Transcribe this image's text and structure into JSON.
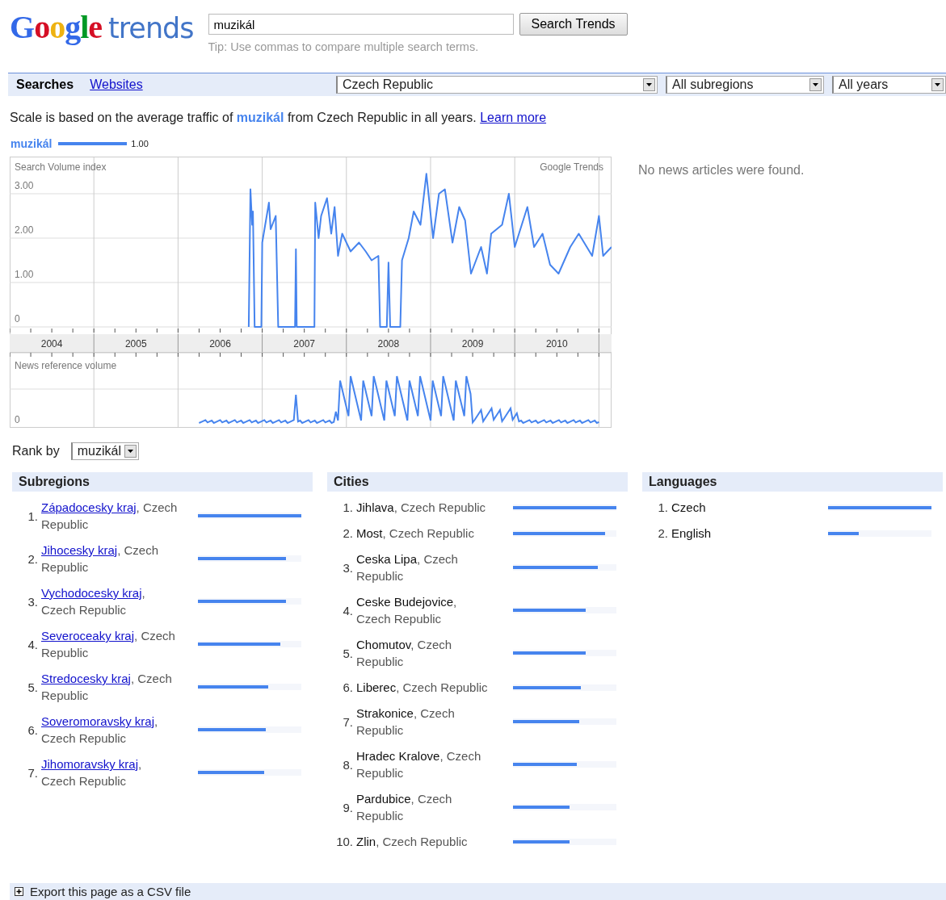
{
  "logo": {
    "brand": "Google",
    "product": "trends"
  },
  "search": {
    "value": "muzikál",
    "button": "Search Trends",
    "tip": "Tip: Use commas to compare multiple search terms."
  },
  "nav": {
    "tabs": [
      {
        "label": "Searches",
        "selected": true
      },
      {
        "label": "Websites",
        "selected": false
      }
    ],
    "filters": [
      {
        "value": "Czech Republic"
      },
      {
        "value": "All subregions"
      },
      {
        "value": "All years"
      }
    ]
  },
  "scale_note": {
    "before": "Scale is based on the average traffic of ",
    "term": "muzikál",
    "after": " from Czech Republic in all years.",
    "link": "Learn more"
  },
  "legend": {
    "value": "1.00"
  },
  "chart": {
    "source": "Google Trends",
    "chart_data": {
      "type": "line",
      "title": "Search Volume index",
      "grid": true,
      "xlim": [
        2004,
        2011.15
      ],
      "ylim": [
        0,
        3.8
      ],
      "xticks": [
        {
          "value": 2004.5,
          "label": "2004"
        },
        {
          "value": 2005.5,
          "label": "2005"
        },
        {
          "value": 2006.5,
          "label": "2006"
        },
        {
          "value": 2007.5,
          "label": "2007"
        },
        {
          "value": 2008.5,
          "label": "2008"
        },
        {
          "value": 2009.5,
          "label": "2009"
        },
        {
          "value": 2010.5,
          "label": "2010"
        }
      ],
      "yticks": [
        {
          "value": 0,
          "label": "0"
        },
        {
          "value": 1,
          "label": "1.00"
        },
        {
          "value": 2,
          "label": "2.00"
        },
        {
          "value": 3,
          "label": "3.00"
        }
      ],
      "x": [
        2006.84,
        2006.86,
        2006.88,
        2006.89,
        2006.91,
        2006.99,
        2007.0,
        2007.08,
        2007.1,
        2007.16,
        2007.19,
        2007.39,
        2007.4,
        2007.41,
        2007.62,
        2007.63,
        2007.67,
        2007.7,
        2007.77,
        2007.82,
        2007.86,
        2007.9,
        2007.95,
        2008.05,
        2008.15,
        2008.23,
        2008.3,
        2008.38,
        2008.4,
        2008.48,
        2008.5,
        2008.52,
        2008.64,
        2008.66,
        2008.74,
        2008.8,
        2008.88,
        2008.95,
        2009.03,
        2009.1,
        2009.17,
        2009.26,
        2009.34,
        2009.41,
        2009.48,
        2009.6,
        2009.67,
        2009.72,
        2009.85,
        2009.93,
        2010.0,
        2010.15,
        2010.23,
        2010.33,
        2010.42,
        2010.52,
        2010.66,
        2010.76,
        2010.92,
        2011.0,
        2011.05,
        2011.15
      ],
      "series": [
        {
          "name": "muzikál",
          "color": "#4684ee",
          "values": [
            0,
            3.1,
            2.3,
            2.6,
            0,
            0,
            1.9,
            2.8,
            2.2,
            2.5,
            0,
            0,
            1.75,
            0,
            0,
            2.8,
            2.0,
            2.5,
            2.9,
            2.1,
            2.7,
            1.6,
            2.1,
            1.7,
            1.9,
            1.7,
            1.5,
            1.6,
            0,
            0,
            1.45,
            0,
            0,
            1.5,
            2.0,
            2.6,
            2.3,
            3.45,
            2.0,
            3.0,
            3.1,
            1.9,
            2.7,
            2.4,
            1.2,
            1.8,
            1.2,
            2.1,
            2.3,
            3.0,
            1.8,
            2.7,
            1.8,
            2.1,
            1.4,
            1.2,
            1.8,
            2.1,
            1.6,
            2.5,
            1.6,
            1.8
          ]
        }
      ]
    }
  },
  "news_chart": {
    "label": "News reference volume",
    "zero": "0"
  },
  "news": {
    "message": "No news articles were found."
  },
  "rank_by": {
    "label": "Rank by",
    "value": "muzikál"
  },
  "lists": [
    {
      "title": "Subregions",
      "kind": "link",
      "items": [
        {
          "rank": "1.",
          "name": "Západocesky kraj",
          "rest": ", Czech Republic",
          "level": 1
        },
        {
          "rank": "2.",
          "name": "Jihocesky kraj",
          "rest": ", Czech Republic",
          "level": 0.85
        },
        {
          "rank": "3.",
          "name": "Vychodocesky kraj",
          "rest": ", Czech Republic",
          "level": 0.85
        },
        {
          "rank": "4.",
          "name": "Severoceaky kraj",
          "rest": ", Czech Republic",
          "level": 0.8
        },
        {
          "rank": "5.",
          "name": "Stredocesky kraj",
          "rest": ", Czech Republic",
          "level": 0.68
        },
        {
          "rank": "6.",
          "name": "Soveromoravsky kraj",
          "rest": ", Czech Republic",
          "level": 0.66
        },
        {
          "rank": "7.",
          "name": "Jihomoravsky kraj",
          "rest": ", Czech Republic",
          "level": 0.64
        }
      ]
    },
    {
      "title": "Cities",
      "kind": "plain",
      "items": [
        {
          "rank": "1.",
          "name": "Jihlava",
          "rest": ", Czech Republic",
          "level": 1
        },
        {
          "rank": "2.",
          "name": "Most",
          "rest": ", Czech Republic",
          "level": 0.89
        },
        {
          "rank": "3.",
          "name": "Ceska Lipa",
          "rest": ", Czech Republic",
          "level": 0.82
        },
        {
          "rank": "4.",
          "name": "Ceske Budejovice",
          "rest": ", Czech Republic",
          "level": 0.7
        },
        {
          "rank": "5.",
          "name": "Chomutov",
          "rest": ", Czech Republic",
          "level": 0.7
        },
        {
          "rank": "6.",
          "name": "Liberec",
          "rest": ", Czech Republic",
          "level": 0.66
        },
        {
          "rank": "7.",
          "name": "Strakonice",
          "rest": ", Czech Republic",
          "level": 0.64
        },
        {
          "rank": "8.",
          "name": "Hradec Kralove",
          "rest": ", Czech Republic",
          "level": 0.62
        },
        {
          "rank": "9.",
          "name": "Pardubice",
          "rest": ", Czech Republic",
          "level": 0.55
        },
        {
          "rank": "10.",
          "name": "Zlin",
          "rest": ", Czech Republic",
          "level": 0.55
        }
      ]
    },
    {
      "title": "Languages",
      "kind": "plain",
      "items": [
        {
          "rank": "1.",
          "name": "Czech",
          "level": 1
        },
        {
          "rank": "2.",
          "name": "English",
          "level": 0.3
        }
      ]
    }
  ],
  "export": {
    "label": "Export this page as a CSV file"
  }
}
